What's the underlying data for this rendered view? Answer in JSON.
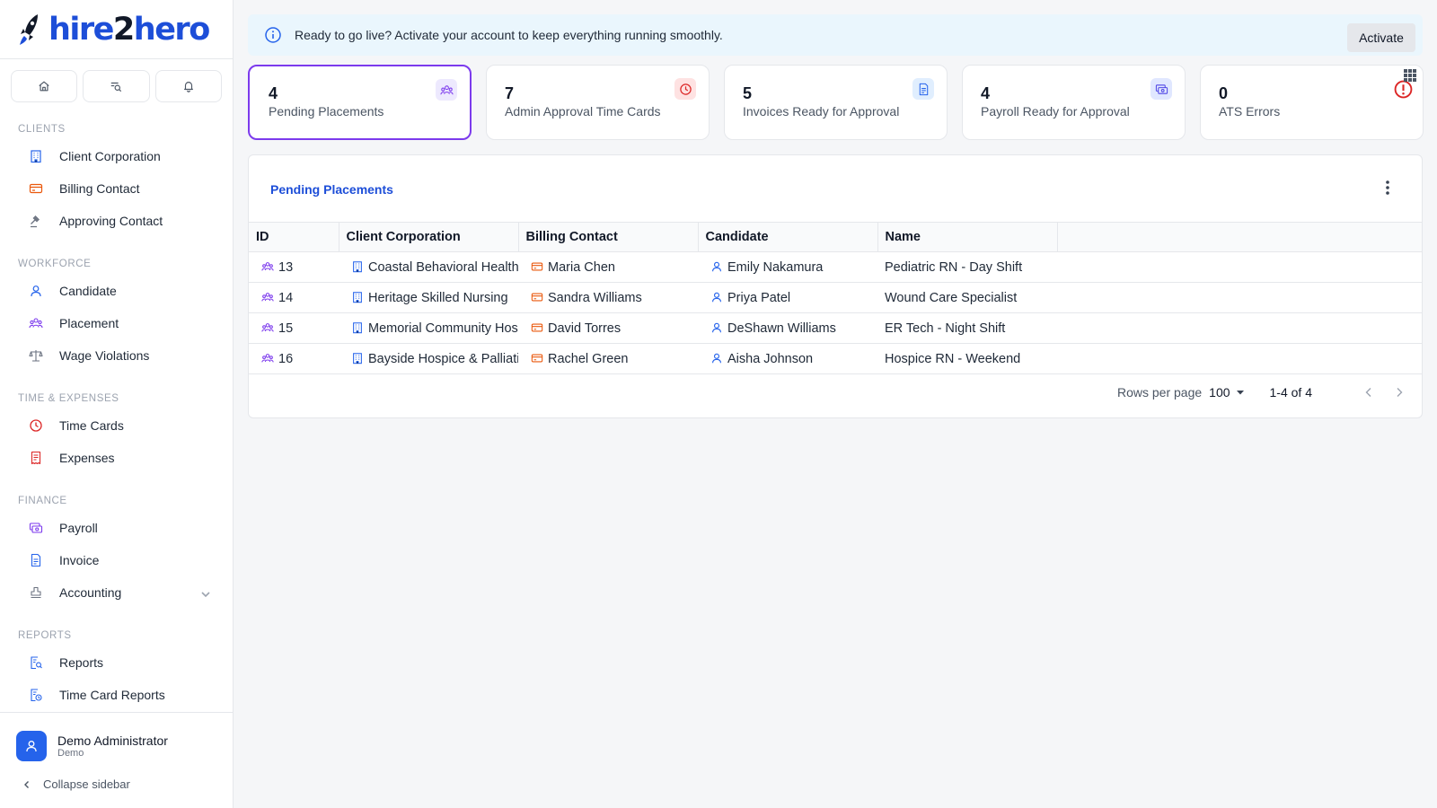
{
  "app": {
    "brand_prefix": "hire",
    "brand_mid": "2",
    "brand_suffix": "hero",
    "accent": "#1d4ed8"
  },
  "sidebar": {
    "quick_actions": [
      {
        "icon": "home-icon"
      },
      {
        "icon": "search-list-icon"
      },
      {
        "icon": "bell-icon"
      }
    ],
    "sections": [
      {
        "title": "CLIENTS",
        "items": [
          {
            "label": "Client Corporation",
            "icon": "building-icon",
            "color": "#2563eb"
          },
          {
            "label": "Billing Contact",
            "icon": "credit-card-icon",
            "color": "#ea580c"
          },
          {
            "label": "Approving Contact",
            "icon": "gavel-icon",
            "color": "#6b7280"
          }
        ]
      },
      {
        "title": "WORKFORCE",
        "items": [
          {
            "label": "Candidate",
            "icon": "user-icon",
            "color": "#2563eb"
          },
          {
            "label": "Placement",
            "icon": "users-icon",
            "color": "#7c3aed"
          },
          {
            "label": "Wage Violations",
            "icon": "scale-icon",
            "color": "#6b7280"
          }
        ]
      },
      {
        "title": "TIME & EXPENSES",
        "items": [
          {
            "label": "Time Cards",
            "icon": "clock-icon",
            "color": "#dc2626"
          },
          {
            "label": "Expenses",
            "icon": "receipt-icon",
            "color": "#dc2626"
          }
        ]
      },
      {
        "title": "FINANCE",
        "items": [
          {
            "label": "Payroll",
            "icon": "money-icon",
            "color": "#7c3aed"
          },
          {
            "label": "Invoice",
            "icon": "document-icon",
            "color": "#2563eb"
          },
          {
            "label": "Accounting",
            "icon": "stamp-icon",
            "color": "#6b7280"
          }
        ]
      },
      {
        "title": "REPORTS",
        "items": [
          {
            "label": "Reports",
            "icon": "report-search-icon",
            "color": "#2563eb"
          },
          {
            "label": "Time Card Reports",
            "icon": "report-clock-icon",
            "color": "#2563eb"
          }
        ]
      }
    ],
    "user": {
      "name": "Demo Administrator",
      "org": "Demo"
    },
    "collapse_label": "Collapse sidebar"
  },
  "banner": {
    "text": "Ready to go live? Activate your account to keep everything running smoothly.",
    "button": "Activate"
  },
  "stats": [
    {
      "value": "4",
      "label": "Pending Placements",
      "icon": "users-icon",
      "color": "#7c3aed",
      "active": true
    },
    {
      "value": "7",
      "label": "Admin Approval Time Cards",
      "icon": "clock-icon",
      "color": "#dc2626",
      "active": false
    },
    {
      "value": "5",
      "label": "Invoices Ready for Approval",
      "icon": "document-icon",
      "color": "#2563eb",
      "active": false
    },
    {
      "value": "4",
      "label": "Payroll Ready for Approval",
      "icon": "money-icon",
      "color": "#4f46e5",
      "active": false
    },
    {
      "value": "0",
      "label": "ATS Errors",
      "icon": "alert-icon",
      "color": "#dc2626",
      "active": false
    }
  ],
  "table": {
    "title": "Pending Placements",
    "columns": [
      "ID",
      "Client Corporation",
      "Billing Contact",
      "Candidate",
      "Name"
    ],
    "rows": [
      {
        "id": "13",
        "client": "Coastal Behavioral Health",
        "billing": "Maria Chen",
        "candidate": "Emily Nakamura",
        "name": "Pediatric RN - Day Shift"
      },
      {
        "id": "14",
        "client": "Heritage Skilled Nursing",
        "billing": "Sandra Williams",
        "candidate": "Priya Patel",
        "name": "Wound Care Specialist"
      },
      {
        "id": "15",
        "client": "Memorial Community Hospital",
        "billing": "David Torres",
        "candidate": "DeShawn Williams",
        "name": "ER Tech - Night Shift"
      },
      {
        "id": "16",
        "client": "Bayside Hospice & Palliative",
        "billing": "Rachel Green",
        "candidate": "Aisha Johnson",
        "name": "Hospice RN - Weekend"
      }
    ],
    "rows_per_page_label": "Rows per page",
    "rows_per_page": "100",
    "range": "1-4 of 4"
  }
}
